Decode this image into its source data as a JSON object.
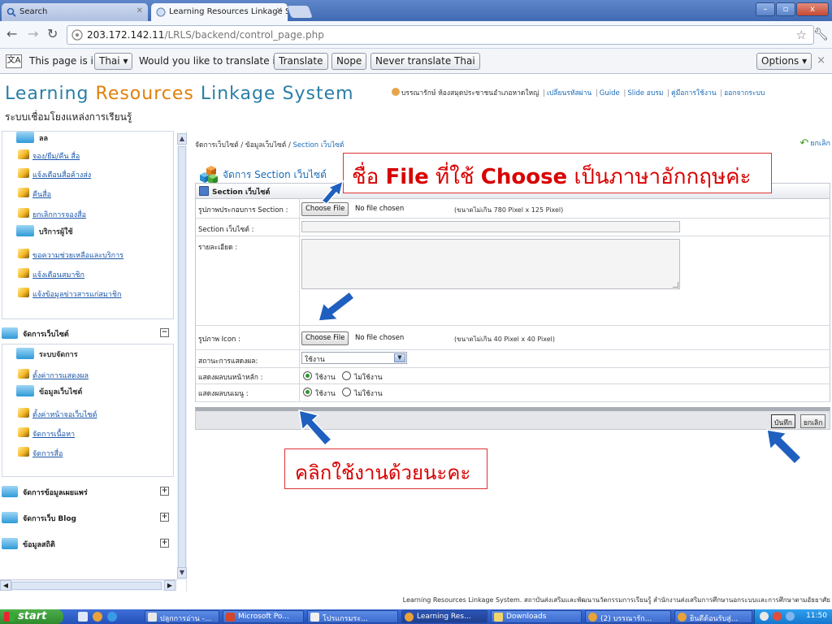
{
  "browser": {
    "tabs": [
      {
        "label": "Search",
        "active": false
      },
      {
        "label": "Learning Resources Linkage S\\",
        "active": true
      }
    ],
    "url_host": "203.172.142.11",
    "url_path": "/LRLS/backend/control_page.php",
    "window_controls": [
      "–",
      "▫",
      "x"
    ]
  },
  "translate_bar": {
    "text_prefix": "This page is in",
    "language": "Thai ▾",
    "question": "Would you like to translate it?",
    "translate_label": "Translate",
    "nope_label": "Nope",
    "never_label": "Never translate Thai",
    "options_label": "Options ▾",
    "close_glyph": "×"
  },
  "site": {
    "logo_part1": "Learning ",
    "logo_part2": "Resources",
    "logo_part3": " Linkage System",
    "logo_sub": "ระบบเชื่อมโยงแหล่งการเรียนรู้",
    "user": "บรรณารักษ์ ห้องสมุดประชาชนอำเภอหาดใหญ่",
    "links": [
      "เปลี่ยนรหัสผ่าน",
      "Guide",
      "Slide อบรม",
      "คู่มือการใช้งาน",
      "ออกจากระบบ"
    ]
  },
  "sidebar": {
    "top_cat": "ลล",
    "links1": [
      "จอง/ยืม/คืน สื่อ",
      "แจ้งเตือนสื่อค้างส่ง",
      "คืนสื่อ",
      "ยกเลิกการจองสื่อ"
    ],
    "cat2": "บริการผู้ใช้",
    "links2": [
      "ขอความช่วยเหลือและบริการ",
      "แจ้งเตือนสมาชิก",
      "แจ้งข้อมูลข่าวสารแก่สมาชิก"
    ],
    "section_website": "จัดการเว็บไซต์",
    "toggle_minus": "−",
    "cat3": "ระบบจัดการ",
    "links3": [
      "ตั้งค่าการแสดงผล"
    ],
    "cat4": "ข้อมูลเว็บไซต์",
    "links4": [
      "ตั้งค่าหน้าจอเว็บไซต์",
      "จัดการเนื้อหา",
      "จัดการสื่อ"
    ],
    "section_publish": "จัดการข้อมูลเผยแพร่",
    "section_blog": "จัดการเว็บ Blog",
    "section_stats": "ข้อมูลสถิติ",
    "toggle_plus": "+"
  },
  "main": {
    "crumb_prefix": "จัดการเว็บไซต์ / ข้อมูลเว็บไซต์ / ",
    "crumb_current": "Section เว็บไซต์",
    "cancel_top": "ยกเลิก",
    "heading": "จัดการ Section เว็บไซต์",
    "annotation_top_a": "ชื่อ ",
    "annotation_top_b": "File",
    "annotation_top_c": " ที่ใช้ ",
    "annotation_top_d": "Choose",
    "annotation_top_e": " เป็นภาษาอักกฤษค่ะ",
    "annotation_bottom": "คลิกใช้งานด้วยนะคะ",
    "form_title": "Section เว็บไซต์",
    "fields": {
      "image_label": "รูปภาพประกอบการ Section :",
      "choose_file": "Choose File",
      "no_file": "No file chosen",
      "image_hint": "(ขนาดไม่เกิน 780 Pixel x 125 Pixel)",
      "section_label": "Section เว็บไซต์ :",
      "detail_label": "รายละเอียด :",
      "icon_label": "รูปภาพ Icon :",
      "icon_hint": "(ขนาดไม่เกิน 40 Pixel x 40 Pixel)",
      "status_label": "สถานะการแสดงผล:",
      "status_value": "ใช้งาน",
      "home_label": "แสดงผลบนหน้าหลัก :",
      "menu_label": "แสดงผลบนเมนู :",
      "radio_on": "ใช้งาน",
      "radio_off": "ไม่ใช้งาน"
    },
    "save_label": "บันทึก",
    "cancel_label": "ยกเลิก"
  },
  "footer": "Learning Resources Linkage System. สถาบันส่งเสริมและพัฒนานวัตกรรมการเรียนรู้ สำนักงานส่งเสริมการศึกษานอกระบบและการศึกษาตามอัธยาศัย",
  "taskbar": {
    "start": "start",
    "tasks": [
      "ปลูกการอ่าน -...",
      "Microsoft Po...",
      "โปรแกรมระ...",
      "Learning Res...",
      "Downloads",
      "(2) บรรณารัก...",
      "ยินดีต้อนรับสู่..."
    ],
    "clock": "11:50"
  },
  "colors": {
    "accent_blue": "#1a6bb8",
    "logo_blue": "#2a7ea6",
    "logo_orange": "#e0800a",
    "annotation_red": "#d80000",
    "annotation_arrow": "#1f5fbf"
  }
}
